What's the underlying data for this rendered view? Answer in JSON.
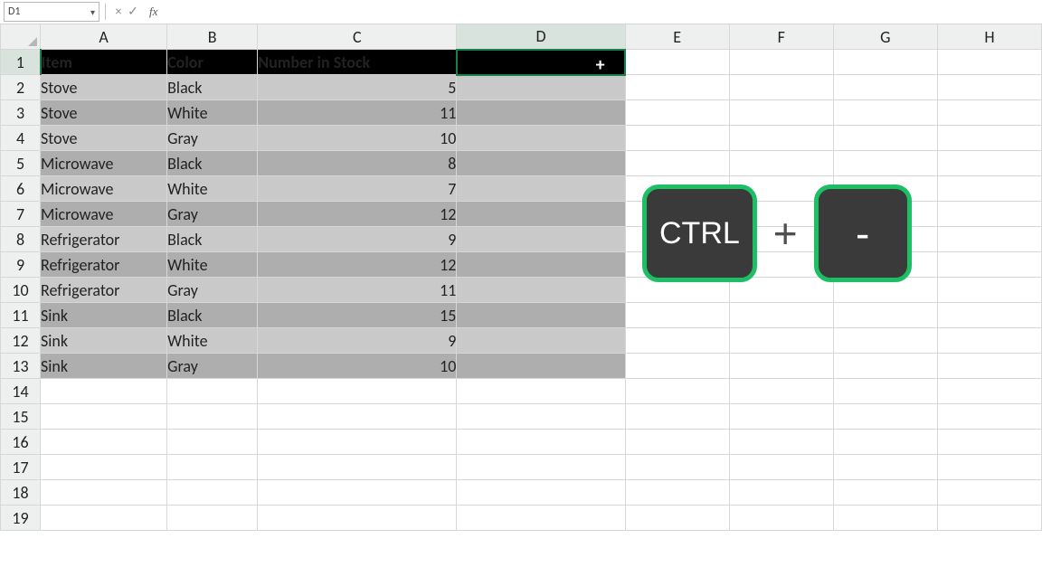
{
  "formula_bar": {
    "name_box": "D1",
    "cancel": "×",
    "confirm": "✓",
    "fx_label": "fx",
    "formula": ""
  },
  "columns": [
    "A",
    "B",
    "C",
    "D",
    "E",
    "F",
    "G",
    "H"
  ],
  "selected_column": "D",
  "selected_row": 1,
  "row_count": 19,
  "table": {
    "headers": {
      "A": "Item",
      "B": "Color",
      "C": "Number in Stock"
    },
    "rows": [
      {
        "A": "Stove",
        "B": "Black",
        "C": 5
      },
      {
        "A": "Stove",
        "B": "White",
        "C": 11
      },
      {
        "A": "Stove",
        "B": "Gray",
        "C": 10
      },
      {
        "A": "Microwave",
        "B": "Black",
        "C": 8
      },
      {
        "A": "Microwave",
        "B": "White",
        "C": 7
      },
      {
        "A": "Microwave",
        "B": "Gray",
        "C": 12
      },
      {
        "A": "Refrigerator",
        "B": "Black",
        "C": 9
      },
      {
        "A": "Refrigerator",
        "B": "White",
        "C": 12
      },
      {
        "A": "Refrigerator",
        "B": "Gray",
        "C": 11
      },
      {
        "A": "Sink",
        "B": "Black",
        "C": 15
      },
      {
        "A": "Sink",
        "B": "White",
        "C": 9
      },
      {
        "A": "Sink",
        "B": "Gray",
        "C": 10
      }
    ]
  },
  "cursor_glyph": "+",
  "shortcut": {
    "key1": "CTRL",
    "joiner": "+",
    "key2": "-"
  }
}
